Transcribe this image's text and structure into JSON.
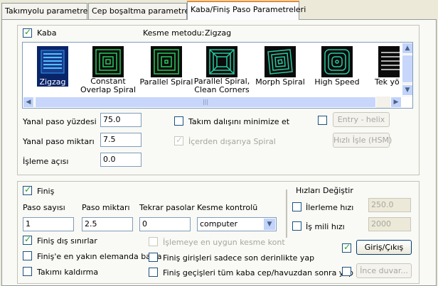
{
  "tabs": [
    "Takımyolu parametreleri",
    "Cep boşaltma parametreleri",
    "Kaba/Finiş Paso Parametreleri"
  ],
  "rough": {
    "checkbox_label": "Kaba",
    "checked": true,
    "method_label": "Kesme metodu:",
    "method_value": "Zigzag",
    "strategies": [
      {
        "label": "Zigzag",
        "icon": "zigzag-icon",
        "selected": true
      },
      {
        "label": "Constant\nOverlap Spiral",
        "icon": "constant-overlap-spiral-icon"
      },
      {
        "label": "Parallel Spiral",
        "icon": "parallel-spiral-icon"
      },
      {
        "label": "Parallel Spiral,\nClean Corners",
        "icon": "parallel-spiral-clean-corners-icon"
      },
      {
        "label": "Morph Spiral",
        "icon": "morph-spiral-icon"
      },
      {
        "label": "High Speed",
        "icon": "high-speed-icon"
      },
      {
        "label": "Tek yö",
        "icon": "one-way-icon"
      }
    ],
    "stepover_percent_label": "Yanal paso yüzdesi",
    "stepover_percent": "75.0",
    "stepover_amount_label": "Yanal paso miktarı",
    "stepover_amount": "7.5",
    "angle_label": "İşleme açısı",
    "angle": "0.0",
    "minimize_label": "Takım dalışını minimize et",
    "spiral_inside_label": "İçerden dışarıya Spiral",
    "entry_helix_label": "Entry - helix",
    "hsm_label": "Hızlı İşle (HSM)"
  },
  "finish": {
    "checkbox_label": "Finiş",
    "checked": true,
    "passes_label": "Paso sayısı",
    "passes": "1",
    "spacing_label": "Paso miktarı",
    "spacing": "2.5",
    "spring_label": "Tekrar pasolar",
    "spring": "0",
    "cutter_comp_label": "Kesme kontrolü",
    "cutter_comp": "computer",
    "outer_label": "Finiş dış sınırlar",
    "start_closest_label": "Finiş'e en yakın elemanda başla",
    "keep_tool_down_label": "Takımı kaldırma",
    "optimize_label": "İşlemeye en uygun kesme kont",
    "final_depth_label": "Finiş girişleri sadece son derinlikte yap",
    "after_all_label": "Finiş geçişleri tüm kaba cep/havuzdan sonra yap",
    "lead_label": "Giriş/Çıkış",
    "thin_wall_label": "İnce duvar..."
  },
  "speed_override": {
    "title": "Hızları Değiştir",
    "feed_label": "İlerleme hızı",
    "feed": "250.0",
    "spindle_label": "İş mili hızı",
    "spindle": "2000"
  }
}
